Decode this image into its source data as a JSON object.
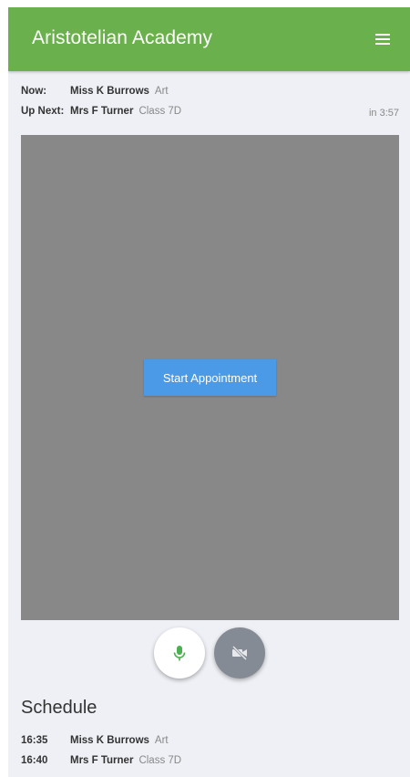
{
  "header": {
    "title": "Aristotelian Academy",
    "menu_icon": "hamburger-menu-icon",
    "color": "#6ab04c"
  },
  "now": {
    "label": "Now:",
    "name": "Miss K Burrows",
    "subject": "Art"
  },
  "up_next": {
    "label": "Up Next:",
    "name": "Mrs F Turner",
    "subject": "Class 7D",
    "countdown": "in 3:57"
  },
  "video": {
    "start_label": "Start Appointment",
    "button_color": "#4a9ae8"
  },
  "controls": {
    "mic_icon": "microphone-icon",
    "camera_icon": "camera-off-icon"
  },
  "schedule": {
    "title": "Schedule",
    "items": [
      {
        "time": "16:35",
        "name": "Miss K Burrows",
        "subject": "Art"
      },
      {
        "time": "16:40",
        "name": "Mrs F Turner",
        "subject": "Class 7D"
      }
    ]
  }
}
